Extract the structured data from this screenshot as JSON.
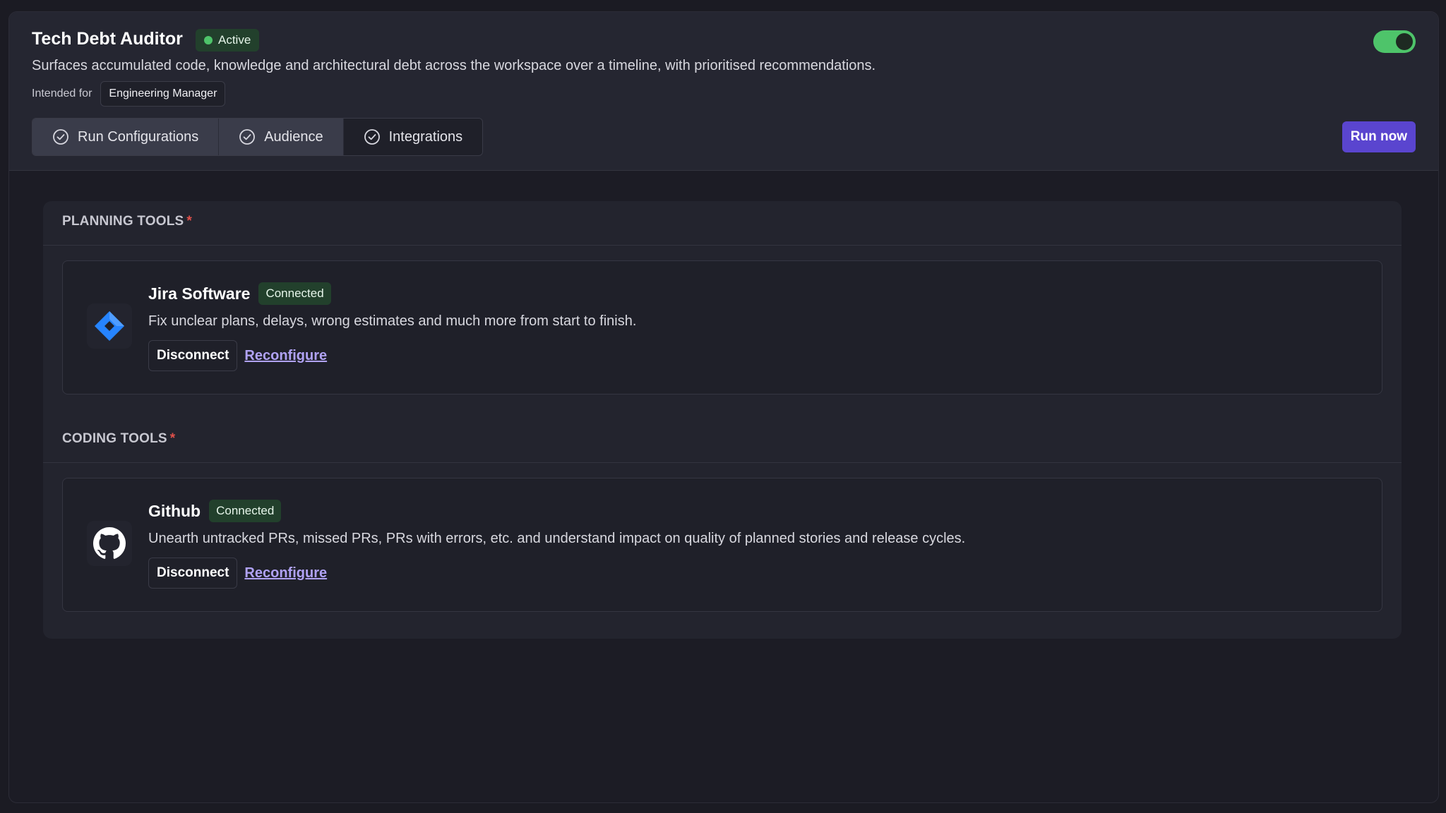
{
  "header": {
    "title": "Tech Debt Auditor",
    "status_label": "Active",
    "description": "Surfaces accumulated code, knowledge and architectural debt across the workspace over a timeline, with prioritised recommendations.",
    "intended_label": "Intended for",
    "intended_value": "Engineering Manager",
    "toggle_on": true,
    "run_button_label": "Run now"
  },
  "tabs": [
    {
      "label": "Run Configurations",
      "icon": "check-circle-icon",
      "active": false
    },
    {
      "label": "Audience",
      "icon": "check-circle-icon",
      "active": false
    },
    {
      "label": "Integrations",
      "icon": "check-circle-icon",
      "active": true
    }
  ],
  "sections": [
    {
      "title": "PLANNING TOOLS",
      "required": "*",
      "tool": {
        "name": "Jira Software",
        "status": "Connected",
        "description": "Fix unclear plans, delays, wrong estimates and much more from start to finish.",
        "icon": "jira-icon",
        "disconnect_label": "Disconnect",
        "reconfigure_label": "Reconfigure"
      }
    },
    {
      "title": "CODING TOOLS",
      "required": "*",
      "tool": {
        "name": "Github",
        "status": "Connected",
        "description": "Unearth untracked PRs, missed PRs, PRs with errors, etc. and understand impact on quality of planned stories and release cycles.",
        "icon": "github-icon",
        "disconnect_label": "Disconnect",
        "reconfigure_label": "Reconfigure"
      }
    }
  ],
  "colors": {
    "accent": "#5a45cf",
    "success": "#4ec46a",
    "link": "#b0a2f4",
    "required": "#e0504a",
    "jira_blue": "#2684ff"
  }
}
